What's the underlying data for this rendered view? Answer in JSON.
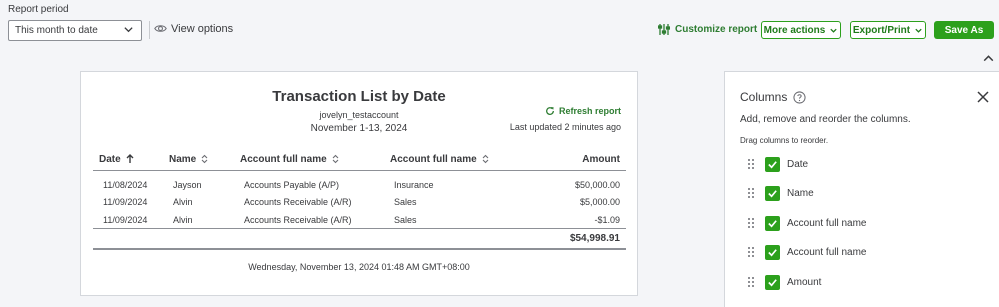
{
  "toolbar": {
    "report_period_label": "Report period",
    "period_value": "This month to date",
    "view_options": "View options",
    "customize_report": "Customize report",
    "more_actions": "More actions",
    "export_print": "Export/Print",
    "save_as": "Save As"
  },
  "report": {
    "title": "Transaction List by Date",
    "company": "jovelyn_testaccount",
    "date_range": "November 1-13, 2024",
    "refresh": "Refresh report",
    "last_updated": "Last updated 2 minutes ago",
    "columns": [
      "Date",
      "Name",
      "Account full name",
      "Account full name",
      "Amount"
    ],
    "rows": [
      {
        "date": "11/08/2024",
        "name": "Jayson",
        "account1": "Accounts Payable (A/P)",
        "account2": "Insurance",
        "amount": "$50,000.00"
      },
      {
        "date": "11/09/2024",
        "name": "Alvin",
        "account1": "Accounts Receivable (A/R)",
        "account2": "Sales",
        "amount": "$5,000.00"
      },
      {
        "date": "11/09/2024",
        "name": "Alvin",
        "account1": "Accounts Receivable (A/R)",
        "account2": "Sales",
        "amount": "-$1.09"
      }
    ],
    "total": "$54,998.91",
    "footer_timestamp": "Wednesday, November 13, 2024 01:48 AM GMT+08:00"
  },
  "panel": {
    "title": "Columns",
    "description": "Add, remove and reorder the columns.",
    "hint": "Drag columns to reorder.",
    "items": [
      {
        "label": "Date",
        "checked": true
      },
      {
        "label": "Name",
        "checked": true
      },
      {
        "label": "Account full name",
        "checked": true
      },
      {
        "label": "Account full name",
        "checked": true
      },
      {
        "label": "Amount",
        "checked": true
      }
    ]
  },
  "colors": {
    "accent": "#2ca01c",
    "accent_text": "#2e7d32",
    "text": "#393a3d",
    "background": "#f4f5f8"
  }
}
